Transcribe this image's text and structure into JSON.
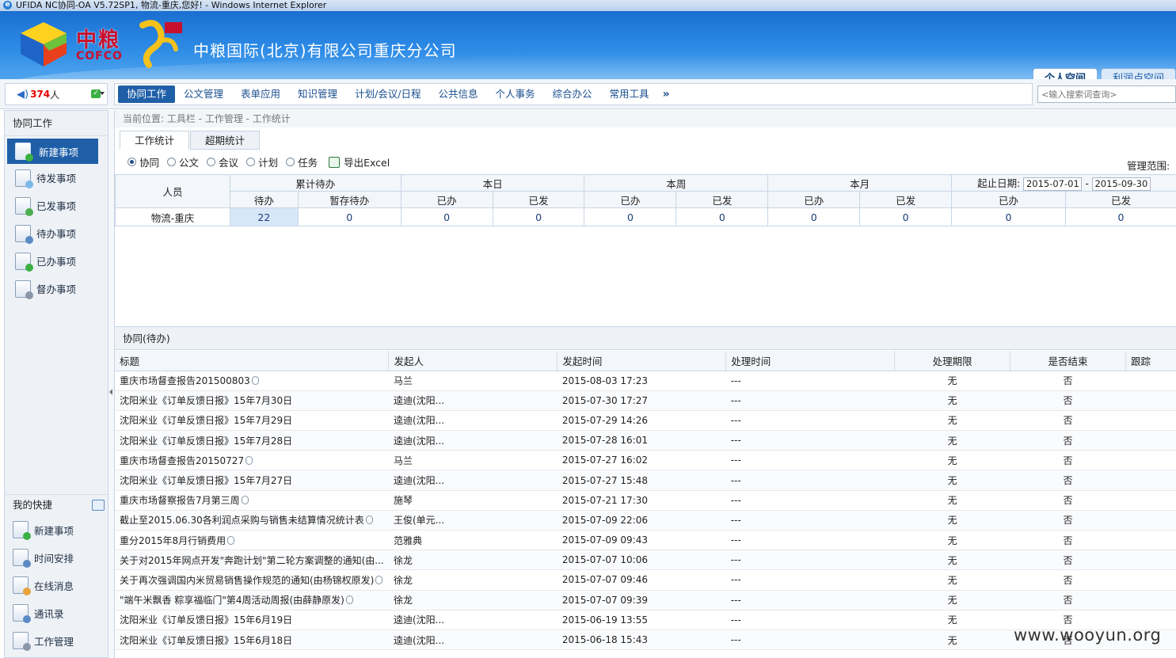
{
  "window": {
    "title": "UFIDA NC协同-OA V5.72SP1, 物流-重庆,您好! - Windows Internet Explorer"
  },
  "header": {
    "logo_cn": "中粮",
    "logo_en": "COFCO",
    "company": "中粮国际(北京)有限公司重庆分公司",
    "space_tabs": [
      "个人空间",
      "利润点空间"
    ]
  },
  "online": {
    "count": "374",
    "unit": "人"
  },
  "nav": {
    "items": [
      "协同工作",
      "公文管理",
      "表单应用",
      "知识管理",
      "计划/会议/日程",
      "公共信息",
      "个人事务",
      "综合办公",
      "常用工具"
    ],
    "more": "»",
    "search_placeholder": "<输入搜索词查询>"
  },
  "sidebar": {
    "title": "协同工作",
    "items": [
      "新建事项",
      "待发事项",
      "已发事项",
      "待办事项",
      "已办事项",
      "督办事项"
    ],
    "quick_title": "我的快捷",
    "quick_items": [
      "新建事项",
      "时间安排",
      "在线消息",
      "通讯录",
      "工作管理"
    ]
  },
  "breadcrumb": "当前位置: 工具栏 - 工作管理 - 工作统计",
  "tabs": [
    "工作统计",
    "超期统计"
  ],
  "filters": [
    "协同",
    "公文",
    "会议",
    "计划",
    "任务"
  ],
  "export_label": "导出Excel",
  "scope_label": "管理范围:",
  "stats": {
    "col_person": "人员",
    "groups": [
      "累计待办",
      "本日",
      "本周",
      "本月"
    ],
    "date_label": "起止日期:",
    "date_from": "2015-07-01",
    "date_sep": "-",
    "date_to": "2015-09-30",
    "sub_pending": "待办",
    "sub_draft": "暂存待办",
    "sub_done": "已办",
    "sub_sent": "已发",
    "row": {
      "person": "物流-重庆",
      "values": [
        "22",
        "0",
        "0",
        "0",
        "0",
        "0",
        "0",
        "0",
        "0",
        "0"
      ]
    }
  },
  "list": {
    "title": "协同(待办)",
    "columns": [
      "标题",
      "发起人",
      "发起时间",
      "处理时间",
      "处理期限",
      "是否结束",
      "跟踪"
    ],
    "rows": [
      {
        "title": "重庆市场督查报告201500803",
        "clip": true,
        "sender": "马兰",
        "time": "2015-08-03 17:23",
        "handled": "---",
        "deadline": "无",
        "ended": "否"
      },
      {
        "title": "沈阳米业《订单反馈日报》15年7月30日",
        "clip": false,
        "sender": "逵迪(沈阳...",
        "time": "2015-07-30 17:27",
        "handled": "---",
        "deadline": "无",
        "ended": "否"
      },
      {
        "title": "沈阳米业《订单反馈日报》15年7月29日",
        "clip": false,
        "sender": "逵迪(沈阳...",
        "time": "2015-07-29 14:26",
        "handled": "---",
        "deadline": "无",
        "ended": "否"
      },
      {
        "title": "沈阳米业《订单反馈日报》15年7月28日",
        "clip": false,
        "sender": "逵迪(沈阳...",
        "time": "2015-07-28 16:01",
        "handled": "---",
        "deadline": "无",
        "ended": "否"
      },
      {
        "title": "重庆市场督查报告20150727",
        "clip": true,
        "sender": "马兰",
        "time": "2015-07-27 16:02",
        "handled": "---",
        "deadline": "无",
        "ended": "否"
      },
      {
        "title": "沈阳米业《订单反馈日报》15年7月27日",
        "clip": false,
        "sender": "逵迪(沈阳...",
        "time": "2015-07-27 15:48",
        "handled": "---",
        "deadline": "无",
        "ended": "否"
      },
      {
        "title": "重庆市场督察报告7月第三周",
        "clip": true,
        "sender": "施琴",
        "time": "2015-07-21 17:30",
        "handled": "---",
        "deadline": "无",
        "ended": "否"
      },
      {
        "title": "截止至2015.06.30各利润点采购与销售未结算情况统计表",
        "clip": true,
        "sender": "王俊(单元...",
        "time": "2015-07-09 22:06",
        "handled": "---",
        "deadline": "无",
        "ended": "否"
      },
      {
        "title": "重分2015年8月行销费用",
        "clip": true,
        "sender": "范雅典",
        "time": "2015-07-09 09:43",
        "handled": "---",
        "deadline": "无",
        "ended": "否"
      },
      {
        "title": "关于对2015年网点开发\"奔跑计划\"第二轮方案调整的通知(由...",
        "clip": false,
        "sender": "徐龙",
        "time": "2015-07-07 10:06",
        "handled": "---",
        "deadline": "无",
        "ended": "否"
      },
      {
        "title": "关于再次强调国内米贸易销售操作规范的通知(由杨锦权原发)",
        "clip": true,
        "sender": "徐龙",
        "time": "2015-07-07 09:46",
        "handled": "---",
        "deadline": "无",
        "ended": "否"
      },
      {
        "title": "\"端午米飘香 粽享福临门\"第4周活动周报(由薛静原发)",
        "clip": true,
        "sender": "徐龙",
        "time": "2015-07-07 09:39",
        "handled": "---",
        "deadline": "无",
        "ended": "否"
      },
      {
        "title": "沈阳米业《订单反馈日报》15年6月19日",
        "clip": false,
        "sender": "逵迪(沈阳...",
        "time": "2015-06-19 13:55",
        "handled": "---",
        "deadline": "无",
        "ended": "否"
      },
      {
        "title": "沈阳米业《订单反馈日报》15年6月18日",
        "clip": false,
        "sender": "逵迪(沈阳...",
        "time": "2015-06-18 15:43",
        "handled": "---",
        "deadline": "无",
        "ended": "否"
      }
    ]
  },
  "watermark": "www.wooyun.org",
  "colors": {
    "accent": "#1f5fa8",
    "header_blue": "#2d8be6",
    "online_red": "#e60000"
  }
}
